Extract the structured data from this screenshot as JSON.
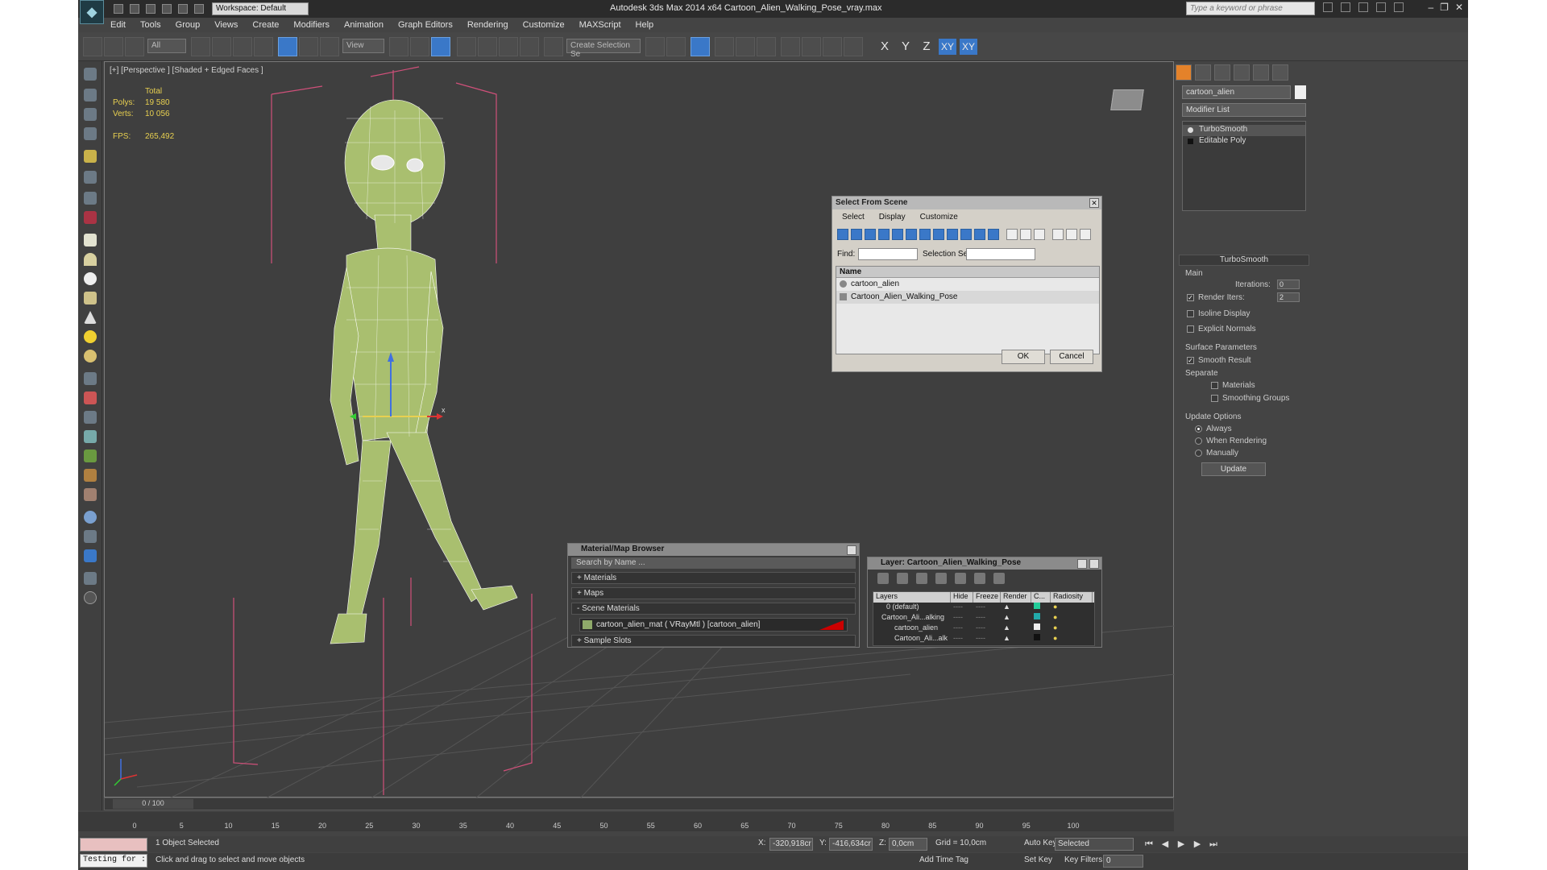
{
  "app": {
    "title": "Autodesk 3ds Max  2014 x64     Cartoon_Alien_Walking_Pose_vray.max",
    "workspace": "Workspace: Default",
    "search_placeholder": "Type a keyword or phrase"
  },
  "menu": [
    "Edit",
    "Tools",
    "Group",
    "Views",
    "Create",
    "Modifiers",
    "Animation",
    "Graph Editors",
    "Rendering",
    "Customize",
    "MAXScript",
    "Help"
  ],
  "toolbar": {
    "selection_filter": "All",
    "ref_coord": "View",
    "named_selection": "Create Selection Se",
    "axis_x": "X",
    "axis_y": "Y",
    "axis_z": "Z",
    "axis_xy": "XY",
    "axis_xy2": "XY"
  },
  "viewport": {
    "label": "[+] [Perspective ] [Shaded + Edged Faces ]",
    "stats": {
      "header": "Total",
      "polys_label": "Polys:",
      "polys": "19 580",
      "verts_label": "Verts:",
      "verts": "10 056",
      "fps_label": "FPS:",
      "fps": "265,492"
    }
  },
  "command_panel": {
    "object_name": "cartoon_alien",
    "modifier_list": "Modifier List",
    "stack": [
      "TurboSmooth",
      "Editable Poly"
    ],
    "rollout_title": "TurboSmooth",
    "main_label": "Main",
    "iterations_label": "Iterations:",
    "iterations": "0",
    "render_iters_label": "Render Iters:",
    "render_iters": "2",
    "isoline": "Isoline Display",
    "explicit": "Explicit Normals",
    "surface_params": "Surface Parameters",
    "smooth_result": "Smooth Result",
    "separate": "Separate",
    "materials": "Materials",
    "smoothing_groups": "Smoothing Groups",
    "update_options": "Update Options",
    "always": "Always",
    "when_rendering": "When Rendering",
    "manually": "Manually",
    "update_btn": "Update"
  },
  "select_from_scene": {
    "title": "Select From Scene",
    "menu": [
      "Select",
      "Display",
      "Customize"
    ],
    "find_label": "Find:",
    "selset_label": "Selection Set:",
    "col_name": "Name",
    "rows": [
      "cartoon_alien",
      "Cartoon_Alien_Walking_Pose"
    ],
    "ok": "OK",
    "cancel": "Cancel"
  },
  "material_browser": {
    "title": "Material/Map Browser",
    "search": "Search by Name ...",
    "materials": "+ Materials",
    "maps": "+ Maps",
    "scene_materials": "- Scene Materials",
    "material_item": "cartoon_alien_mat  ( VRayMtl ) [cartoon_alien]",
    "sample_slots": "+ Sample Slots"
  },
  "layer_dialog": {
    "title": "Layer: Cartoon_Alien_Walking_Pose",
    "help": "?",
    "columns": [
      "Layers",
      "Hide",
      "Freeze",
      "Render",
      "C...",
      "Radiosity"
    ],
    "rows": [
      "0 (default)",
      "Cartoon_Ali...alking",
      "cartoon_alien",
      "Cartoon_Ali...alk"
    ]
  },
  "timeline": {
    "frame": "0 / 100",
    "ticks": [
      "0",
      "5",
      "10",
      "15",
      "20",
      "25",
      "30",
      "35",
      "40",
      "45",
      "50",
      "55",
      "60",
      "65",
      "70",
      "75",
      "80",
      "85",
      "90",
      "95",
      "100"
    ]
  },
  "status": {
    "maxscript_text": "Testing for :",
    "selected": "1 Object Selected",
    "hint": "Click and drag to select and move objects",
    "x_label": "X:",
    "x": "-320,918cr",
    "y_label": "Y:",
    "y": "-416,634cr",
    "z_label": "Z:",
    "z": "0,0cm",
    "grid": "Grid = 10,0cm",
    "add_time_tag": "Add Time Tag",
    "auto_key": "Auto Key",
    "auto_key_value": "Selected",
    "set_key": "Set Key",
    "key_filters": "Key Filters...",
    "current_frame": "0"
  },
  "colors": {
    "accent_blue": "#3a78c8",
    "mesh_green": "#a9bf6f",
    "bounding_pink": "#d0507a",
    "stats_yellow": "#e8d050",
    "panel_orange": "#e4822a"
  }
}
